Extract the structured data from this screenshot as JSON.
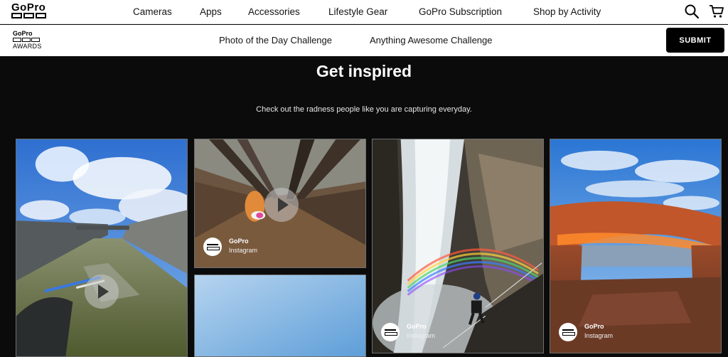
{
  "header": {
    "brand": "GoPro",
    "nav": [
      "Cameras",
      "Apps",
      "Accessories",
      "Lifestyle Gear",
      "GoPro Subscription",
      "Shop by Activity"
    ],
    "icons": [
      "search-icon",
      "cart-icon"
    ]
  },
  "subnav": {
    "awards_brand": "GoPro",
    "awards_label": "AWARDS",
    "links": [
      "Photo of the Day Challenge",
      "Anything Awesome Challenge"
    ],
    "submit_label": "SUBMIT"
  },
  "main": {
    "title": "Get inspired",
    "subtitle": "Check out the radness people like you are capturing everyday.",
    "tiles": [
      {
        "scene": "dam spillway skate with sky",
        "has_play": true,
        "account": "",
        "source": ""
      },
      {
        "scene": "forest motion blur rider",
        "has_play": true,
        "account": "GoPro",
        "source": "Instagram"
      },
      {
        "scene": "blue sky",
        "has_play": false,
        "account": "",
        "source": ""
      },
      {
        "scene": "waterfall rappel with rainbow",
        "has_play": false,
        "account": "GoPro",
        "source": "Instagram"
      },
      {
        "scene": "desert stone arch at sunrise",
        "has_play": false,
        "account": "GoPro",
        "source": "Instagram"
      }
    ]
  },
  "colors": {
    "page_bg": "#0b0b0b",
    "header_bg": "#ffffff",
    "button_bg": "#000000"
  }
}
